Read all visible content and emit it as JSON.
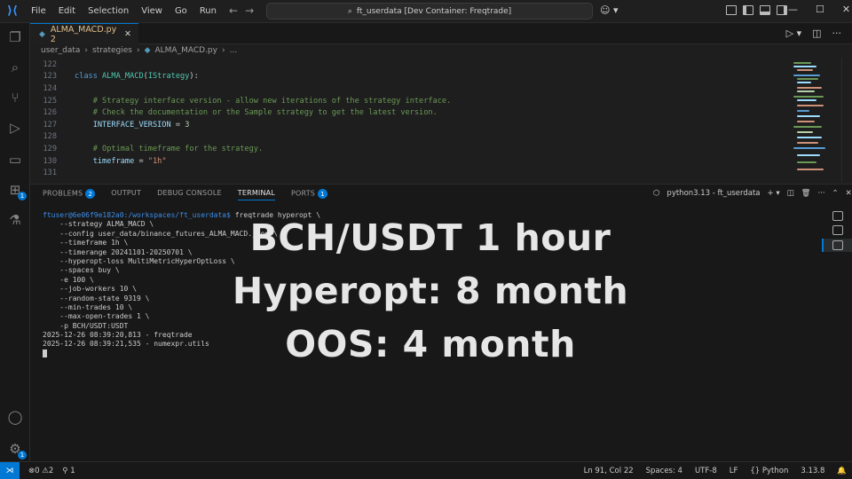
{
  "titlebar": {
    "menu": [
      "File",
      "Edit",
      "Selection",
      "View",
      "Go",
      "Run"
    ],
    "search": "ft_userdata [Dev Container: Freqtrade]"
  },
  "tab": {
    "label": "ALMA_MACD.py 2"
  },
  "breadcrumb": [
    "user_data",
    "strategies",
    "ALMA_MACD.py",
    "..."
  ],
  "code": [
    {
      "n": "122",
      "t": ""
    },
    {
      "n": "123",
      "t": "class ALMA_MACD(IStrategy):"
    },
    {
      "n": "124",
      "t": ""
    },
    {
      "n": "125",
      "t": "    # Strategy interface version - allow new iterations of the strategy interface."
    },
    {
      "n": "126",
      "t": "    # Check the documentation or the Sample strategy to get the latest version."
    },
    {
      "n": "127",
      "t": "    INTERFACE_VERSION = 3"
    },
    {
      "n": "128",
      "t": ""
    },
    {
      "n": "129",
      "t": "    # Optimal timeframe for the strategy."
    },
    {
      "n": "130",
      "t": "    timeframe = \"1h\""
    },
    {
      "n": "131",
      "t": ""
    }
  ],
  "panel": {
    "tabs": [
      "PROBLEMS",
      "OUTPUT",
      "DEBUG CONSOLE",
      "TERMINAL",
      "PORTS"
    ],
    "problems_count": "2",
    "ports_count": "1",
    "terminal_name": "python3.13 - ft_userdata"
  },
  "terminal": {
    "prompt": "ftuser@6e06f9e182a0:/workspaces/ft_userdata$",
    "command": " freqtrade hyperopt \\",
    "lines": [
      "    --strategy ALMA_MACD \\",
      "    --config user_data/binance_futures_ALMA_MACD.json \\",
      "    --timeframe 1h \\",
      "    --timerange 20241101-20250701 \\",
      "    --hyperopt-loss MultiMetricHyperOptLoss \\",
      "    --spaces buy \\",
      "    -e 100 \\",
      "    --job-workers 10 \\",
      "    --random-state 9319 \\",
      "    --min-trades 10 \\",
      "    --max-open-trades 1 \\",
      "    -p BCH/USDT:USDT",
      "2025-12-26 08:39:20,813 - freqtrade",
      "2025-12-26 08:39:21,535 - numexpr.utils"
    ]
  },
  "overlay": [
    "BCH/USDT 1 hour",
    "Hyperopt: 8 month",
    "OOS: 4 month"
  ],
  "status": {
    "problems": "⊗0 ⚠2",
    "ports": "1",
    "position": "Ln 91, Col 22",
    "spaces": "Spaces: 4",
    "encoding": "UTF-8",
    "eol": "LF",
    "language": "Python",
    "version": "3.13.8"
  }
}
